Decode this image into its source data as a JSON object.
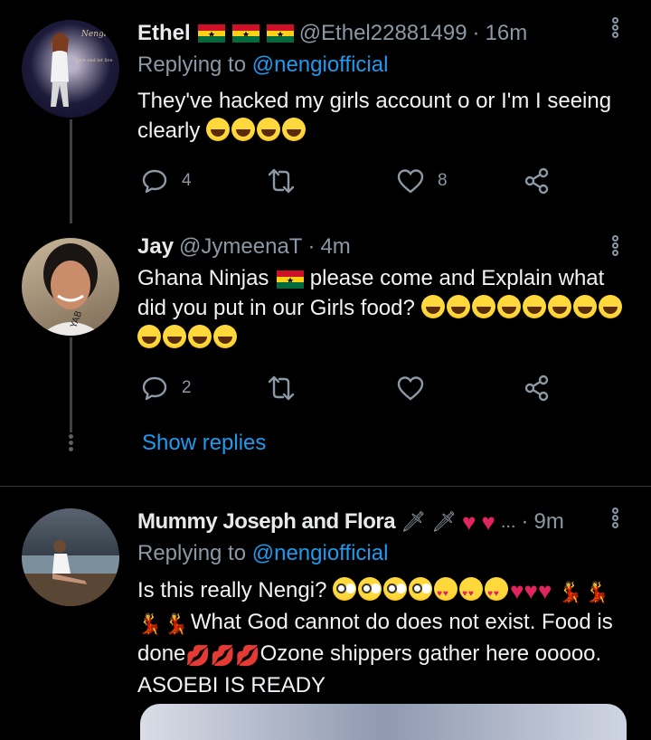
{
  "tweets": [
    {
      "name": "Ethel",
      "handle": "@Ethel22881499",
      "sep": "·",
      "time": "16m",
      "replying_prefix": "Replying to",
      "replying_to": "@nengiofficial",
      "text": "They've hacked my girls account o or I'm I seeing clearly",
      "replies": "4",
      "likes": "8"
    },
    {
      "name": "Jay",
      "handle": "@JymeenaT",
      "sep": "·",
      "time": "4m",
      "text_part1": "Ghana Ninjas",
      "text_part2": "please come and Explain what did you put in our Girls food?",
      "replies": "2",
      "show_replies": "Show replies"
    },
    {
      "name": "Mummy Joseph and Flora",
      "ellipsis": "...",
      "sep": "·",
      "time": "9m",
      "replying_prefix": "Replying to",
      "replying_to": "@nengiofficial",
      "text_a": "Is this really Nengi?",
      "text_b": "What God cannot do does not exist.",
      "text_c": "Food is done",
      "text_d": "Ozone shippers gather here ooooo. ASOEBI IS READY"
    }
  ],
  "colors": {
    "link": "#1d9bf0",
    "muted": "#8b98a5",
    "background": "#000000"
  },
  "icons": [
    "reply-icon",
    "retweet-icon",
    "like-icon",
    "share-icon",
    "more-icon"
  ]
}
